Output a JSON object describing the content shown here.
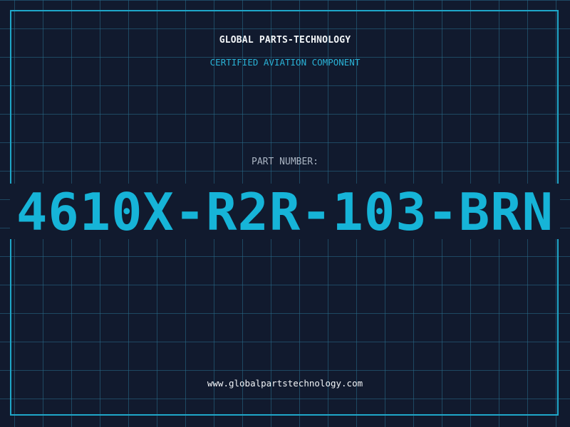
{
  "header": {
    "brand": "GLOBAL PARTS-TECHNOLOGY",
    "tagline": "CERTIFIED AVIATION COMPONENT"
  },
  "part": {
    "label": "PART NUMBER:",
    "number": "4610X-R2R-103-BRN"
  },
  "footer": {
    "url": "www.globalpartstechnology.com"
  },
  "colors": {
    "background": "#111a2e",
    "grid": "#286e8c",
    "frame": "#1fa7c9",
    "accent": "#16b4d8",
    "text": "#f2f5f8"
  }
}
